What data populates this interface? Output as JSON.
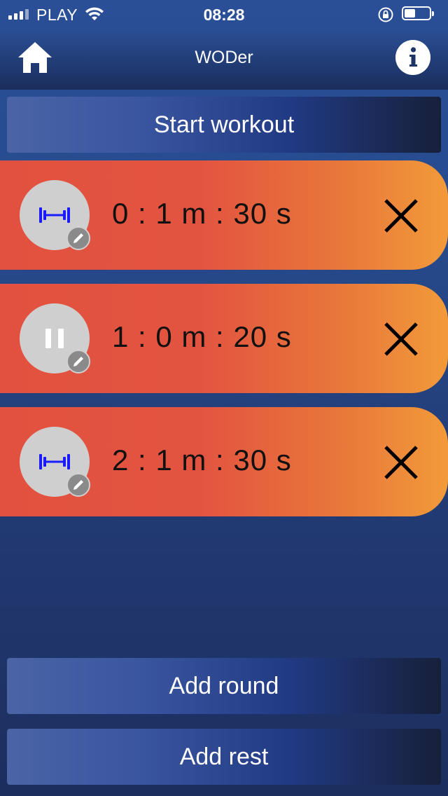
{
  "status": {
    "carrier": "PLAY",
    "time": "08:28"
  },
  "header": {
    "title": "WODer",
    "home_icon": "home-icon",
    "info_icon": "info-icon"
  },
  "actions": {
    "start": "Start workout",
    "add_round": "Add round",
    "add_rest": "Add rest"
  },
  "rounds": [
    {
      "type": "exercise",
      "icon": "dumbbell-icon",
      "time": "0 : 1 m : 30 s"
    },
    {
      "type": "rest",
      "icon": "pause-icon",
      "time": "1 : 0 m : 20 s"
    },
    {
      "type": "exercise",
      "icon": "dumbbell-icon",
      "time": "2 : 1 m : 30 s"
    }
  ],
  "colors": {
    "row_start": "#e2513f",
    "row_end": "#f29a3a",
    "dumbbell": "#1a1aff",
    "background": "#264a8c"
  },
  "battery_level": 0.45
}
